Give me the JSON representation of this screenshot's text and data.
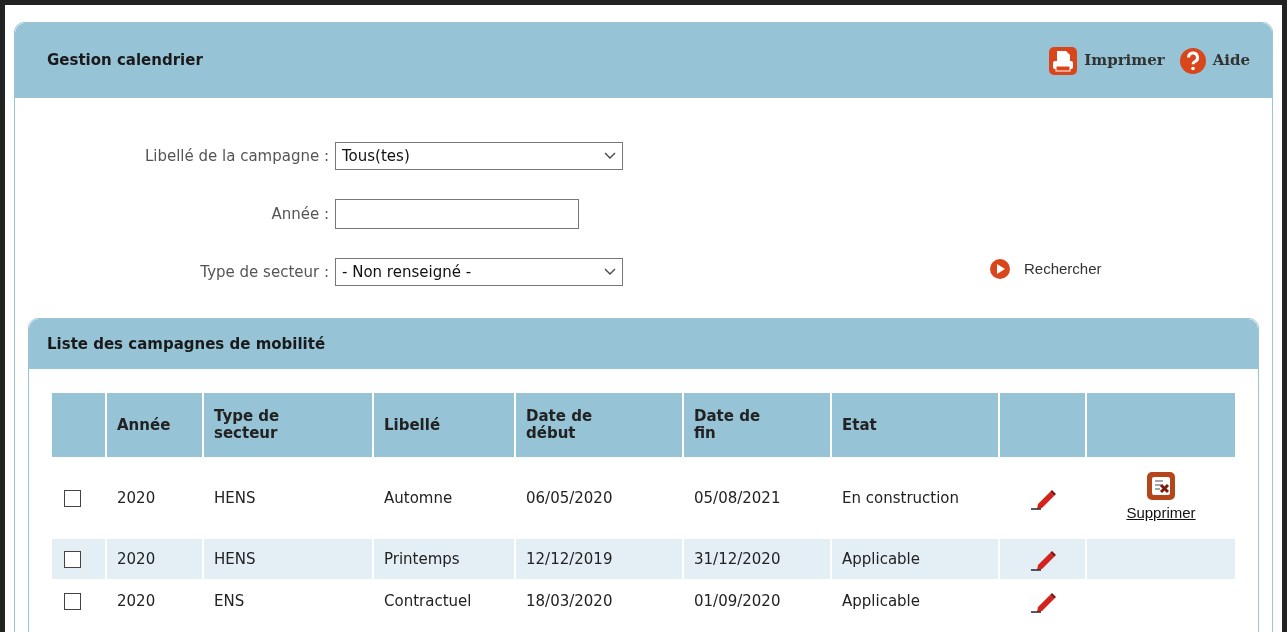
{
  "header": {
    "title": "Gestion calendrier",
    "actions": [
      {
        "kind": "print",
        "label": "Imprimer"
      },
      {
        "kind": "help",
        "label": "Aide"
      }
    ]
  },
  "filters": [
    {
      "kind": "select",
      "label": "Libellé de la campagne :",
      "value": "Tous(tes)"
    },
    {
      "kind": "text",
      "label": "Année :"
    },
    {
      "kind": "select",
      "label": "Type de secteur :",
      "value": "- Non renseigné -"
    }
  ],
  "search_button": "Rechercher",
  "list": {
    "title": "Liste des campagnes de mobilité",
    "columns": [
      "Année",
      "Type de secteur",
      "Libellé",
      "Date de début",
      "Date de fin",
      "Etat"
    ],
    "rows": [
      {
        "checked": false,
        "cells": [
          "2020",
          "HENS",
          "Automne",
          "06/05/2020",
          "05/08/2021",
          "En construction"
        ],
        "delete_label": "Supprimer"
      },
      {
        "checked": false,
        "cells": [
          "2020",
          "HENS",
          "Printemps",
          "12/12/2019",
          "31/12/2020",
          "Applicable"
        ]
      },
      {
        "checked": false,
        "cells": [
          "2020",
          "ENS",
          "Contractuel",
          "18/03/2020",
          "01/09/2020",
          "Applicable"
        ]
      }
    ]
  }
}
